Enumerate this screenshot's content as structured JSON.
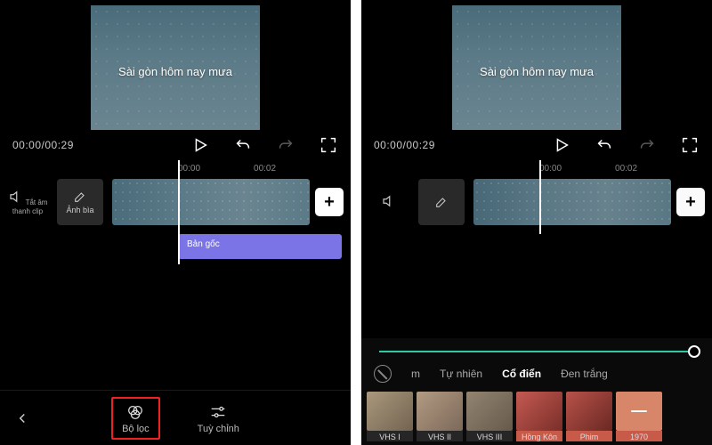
{
  "preview": {
    "caption": "Sài gòn hôm nay mưa"
  },
  "transport": {
    "time": "00:00/00:29"
  },
  "timeline": {
    "ticks": [
      "00:00",
      "00:02"
    ],
    "mute_label": "Tắt âm thanh clip",
    "cover_label": "Ảnh bìa",
    "text_track_label": "Bản gốc"
  },
  "bottom_nav": {
    "filter_label": "Bộ lọc",
    "adjust_label": "Tuỳ chỉnh"
  },
  "filter_panel": {
    "tabs": {
      "partial": "m",
      "natural": "Tự nhiên",
      "classic": "Cổ điển",
      "bw": "Đen trắng"
    },
    "thumbs": {
      "vhs1": "VHS I",
      "vhs2": "VHS II",
      "vhs3": "VHS III",
      "hongkong": "Hồng Kôn",
      "phim": "Phim",
      "y1970": "1970"
    }
  }
}
